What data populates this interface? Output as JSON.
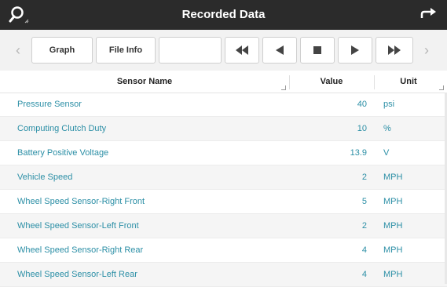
{
  "titlebar": {
    "title": "Recorded Data",
    "left_icon": "search-icon",
    "right_icon": "back-arrow-icon"
  },
  "toolbar": {
    "graph_label": "Graph",
    "file_info_label": "File Info",
    "blank_label": "",
    "rewind_icon": "fast-rewind-icon",
    "prev_icon": "step-back-icon",
    "stop_icon": "stop-icon",
    "play_icon": "play-icon",
    "forward_icon": "fast-forward-icon"
  },
  "table": {
    "headers": {
      "name": "Sensor Name",
      "value": "Value",
      "unit": "Unit"
    },
    "rows": [
      {
        "name": "Pressure Sensor",
        "value": "40",
        "unit": "psi"
      },
      {
        "name": "Computing Clutch Duty",
        "value": "10",
        "unit": "%"
      },
      {
        "name": "Battery Positive Voltage",
        "value": "13.9",
        "unit": "V"
      },
      {
        "name": "Vehicle Speed",
        "value": "2",
        "unit": "MPH"
      },
      {
        "name": "Wheel Speed Sensor-Right Front",
        "value": "5",
        "unit": "MPH"
      },
      {
        "name": "Wheel Speed Sensor-Left Front",
        "value": "2",
        "unit": "MPH"
      },
      {
        "name": "Wheel Speed Sensor-Right Rear",
        "value": "4",
        "unit": "MPH"
      },
      {
        "name": "Wheel Speed Sensor-Left Rear",
        "value": "4",
        "unit": "MPH"
      }
    ]
  },
  "colors": {
    "titlebar": "#2b2b2b",
    "link_text": "#2c8fa6",
    "alt_row": "#f5f5f5"
  }
}
